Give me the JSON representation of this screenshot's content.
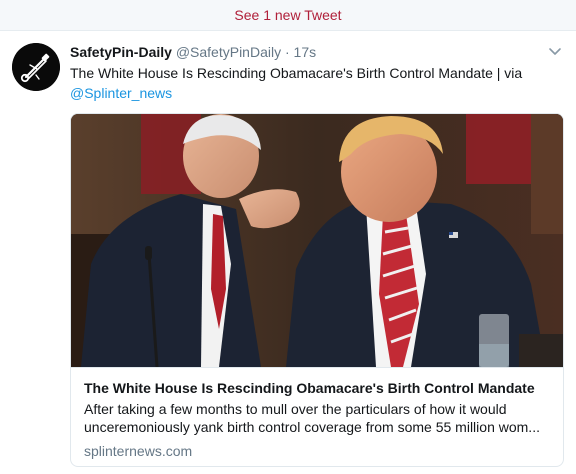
{
  "new_tweets_bar": {
    "label": "See 1 new Tweet"
  },
  "tweet": {
    "display_name": "SafetyPin-Daily",
    "screen_name": "@SafetyPinDaily",
    "separator": "·",
    "time": "17s",
    "text_main": "The White House Is Rescinding Obamacare's Birth Control Mandate | via",
    "mention": "@Splinter_news",
    "card": {
      "title": "The White House Is Rescinding Obamacare's Birth Control Mandate",
      "description_line1": "After taking a few months to mull over the particulars of how it would",
      "description_line2": "unceremoniously yank birth control coverage from some 55 million wom...",
      "domain": "splinternews.com"
    }
  },
  "colors": {
    "link_blue": "#1b95e0",
    "new_tweet_red": "#b0203a",
    "muted_gray": "#657786"
  },
  "icons": {
    "caret": "chevron-down-icon",
    "avatar": "safety-pin-logo"
  }
}
